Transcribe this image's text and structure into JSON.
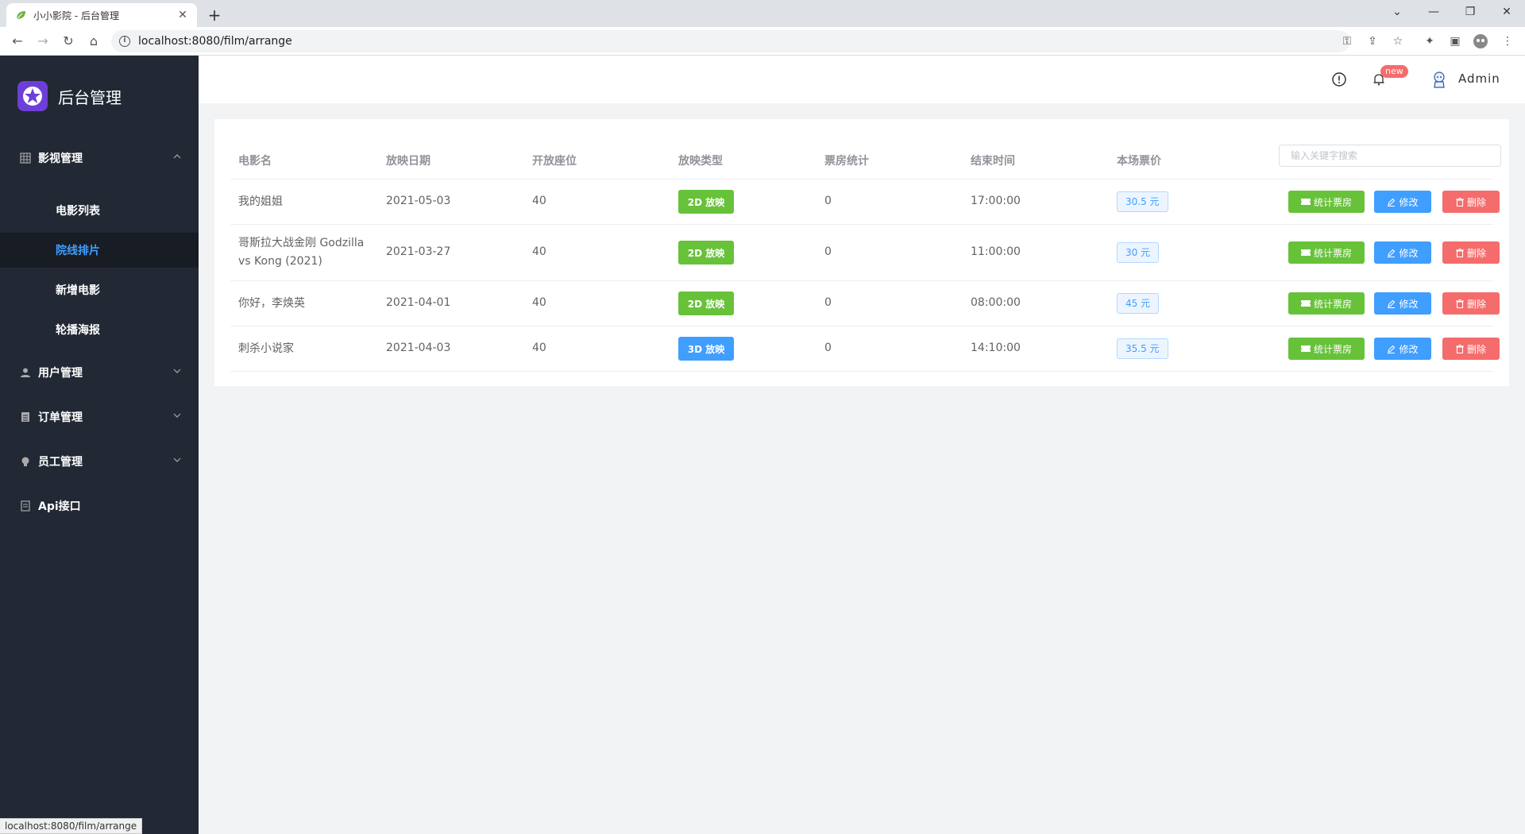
{
  "browser": {
    "tab_title": "小小影院 - 后台管理",
    "url": "localhost:8080/film/arrange",
    "status_url": "localhost:8080/film/arrange"
  },
  "sidebar": {
    "brand": "后台管理",
    "groups": [
      {
        "label": "影视管理",
        "icon": "grid-icon",
        "expanded": true
      },
      {
        "label": "用户管理",
        "icon": "user-icon",
        "expanded": false
      },
      {
        "label": "订单管理",
        "icon": "document-icon",
        "expanded": false
      },
      {
        "label": "员工管理",
        "icon": "bulb-icon",
        "expanded": false
      },
      {
        "label": "Api接口",
        "icon": "file-icon"
      }
    ],
    "sub_items": [
      {
        "label": "电影列表",
        "active": false
      },
      {
        "label": "院线排片",
        "active": true
      },
      {
        "label": "新增电影",
        "active": false
      },
      {
        "label": "轮播海报",
        "active": false
      }
    ]
  },
  "header": {
    "badge": "new",
    "user": "Admin"
  },
  "table": {
    "columns": [
      "电影名",
      "放映日期",
      "开放座位",
      "放映类型",
      "票房统计",
      "结束时间",
      "本场票价"
    ],
    "search_placeholder": "输入关键字搜索",
    "rows": [
      {
        "name": "我的姐姐",
        "date": "2021-05-03",
        "seats": "40",
        "type": "2D 放映",
        "type_kind": "2d",
        "box_office": "0",
        "end_time": "17:00:00",
        "price": "30.5 元"
      },
      {
        "name": "哥斯拉大战金刚 Godzilla vs Kong (2021)",
        "date": "2021-03-27",
        "seats": "40",
        "type": "2D 放映",
        "type_kind": "2d",
        "box_office": "0",
        "end_time": "11:00:00",
        "price": "30 元"
      },
      {
        "name": "你好，李焕英",
        "date": "2021-04-01",
        "seats": "40",
        "type": "2D 放映",
        "type_kind": "2d",
        "box_office": "0",
        "end_time": "08:00:00",
        "price": "45 元"
      },
      {
        "name": "刺杀小说家",
        "date": "2021-04-03",
        "seats": "40",
        "type": "3D 放映",
        "type_kind": "3d",
        "box_office": "0",
        "end_time": "14:10:00",
        "price": "35.5 元"
      }
    ],
    "actions": {
      "stat": "统计票房",
      "edit": "修改",
      "delete": "删除"
    }
  },
  "colors": {
    "sidebar_bg": "#222834",
    "active": "#409eff",
    "success": "#67c23a",
    "danger": "#f56c6c"
  }
}
